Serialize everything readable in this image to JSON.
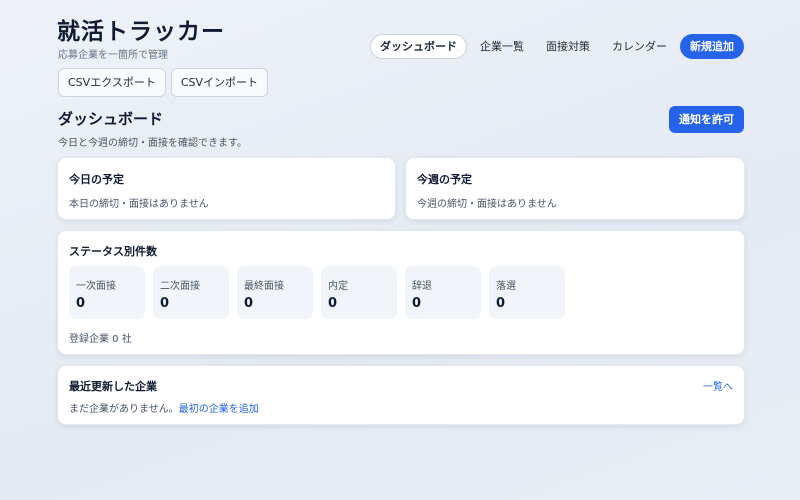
{
  "header": {
    "title": "就活トラッカー",
    "subtitle": "応募企業を一箇所で管理",
    "csv_export": "CSVエクスポート",
    "csv_import": "CSVインポート"
  },
  "nav": {
    "items": [
      "ダッシュボード",
      "企業一覧",
      "面接対策",
      "カレンダー"
    ],
    "active": "ダッシュボード",
    "add_new": "新規追加"
  },
  "dashboard": {
    "title": "ダッシュボード",
    "description": "今日と今週の締切・面接を確認できます。",
    "notify_button": "通知を許可"
  },
  "today": {
    "title": "今日の予定",
    "empty": "本日の締切・面接はありません"
  },
  "week": {
    "title": "今週の予定",
    "empty": "今週の締切・面接はありません"
  },
  "status": {
    "title": "ステータス別件数",
    "items": [
      {
        "label": "一次面接",
        "count": "0"
      },
      {
        "label": "二次面接",
        "count": "0"
      },
      {
        "label": "最終面接",
        "count": "0"
      },
      {
        "label": "内定",
        "count": "0"
      },
      {
        "label": "辞退",
        "count": "0"
      },
      {
        "label": "落選",
        "count": "0"
      }
    ],
    "total": "登録企業 0 社"
  },
  "recent": {
    "title": "最近更新した企業",
    "view_all": "一覧へ",
    "empty_text": "まだ企業がありません。",
    "add_first_link": "最初の企業を追加"
  },
  "colors": {
    "accent": "#2563eb",
    "heading": "#0f1b33",
    "background": "#e8edf4"
  }
}
